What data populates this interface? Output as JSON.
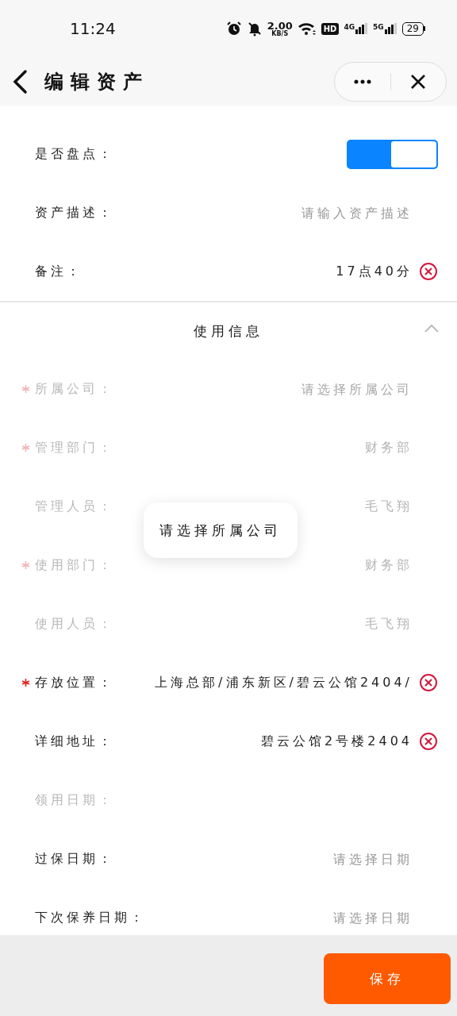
{
  "status_bar": {
    "time": "11:24",
    "speed": "2.00",
    "speed_unit": "KB/S",
    "hd": "HD",
    "sim1": "4G",
    "sim2": "5G",
    "battery": "29"
  },
  "header": {
    "title": "编辑资产"
  },
  "basic_rows": [
    {
      "kind": "switch",
      "label": "是否盘点：",
      "required": false,
      "disabled": false,
      "on": true
    },
    {
      "kind": "field",
      "label": "资产描述：",
      "required": false,
      "disabled": false,
      "placeholder": "请输入资产描述"
    },
    {
      "kind": "field",
      "label": "备注：",
      "required": false,
      "disabled": false,
      "value": "17点40分",
      "clearable": true
    }
  ],
  "section": {
    "title": "使用信息",
    "expanded": true
  },
  "usage_rows": [
    {
      "kind": "field",
      "label": "所属公司：",
      "required": true,
      "disabled": true,
      "placeholder": "请选择所属公司"
    },
    {
      "kind": "field",
      "label": "管理部门：",
      "required": true,
      "disabled": true,
      "value": "财务部"
    },
    {
      "kind": "field",
      "label": "管理人员：",
      "required": false,
      "disabled": true,
      "value": "毛飞翔"
    },
    {
      "kind": "field",
      "label": "使用部门：",
      "required": true,
      "disabled": true,
      "value": "财务部"
    },
    {
      "kind": "field",
      "label": "使用人员：",
      "required": false,
      "disabled": true,
      "value": "毛飞翔"
    },
    {
      "kind": "field",
      "label": "存放位置：",
      "required": true,
      "disabled": false,
      "value": "上海总部/浦东新区/碧云公馆2404/",
      "clearable": true
    },
    {
      "kind": "field",
      "label": "详细地址：",
      "required": false,
      "disabled": false,
      "value": "碧云公馆2号楼2404",
      "clearable": true
    },
    {
      "kind": "field",
      "label": "领用日期：",
      "required": false,
      "disabled": true
    },
    {
      "kind": "field",
      "label": "过保日期：",
      "required": false,
      "disabled": false,
      "placeholder": "请选择日期"
    },
    {
      "kind": "field",
      "label": "下次保养日期：",
      "required": false,
      "disabled": false,
      "placeholder": "请选择日期"
    }
  ],
  "toast": {
    "message": "请选择所属公司"
  },
  "footer": {
    "save_button": "保存"
  }
}
